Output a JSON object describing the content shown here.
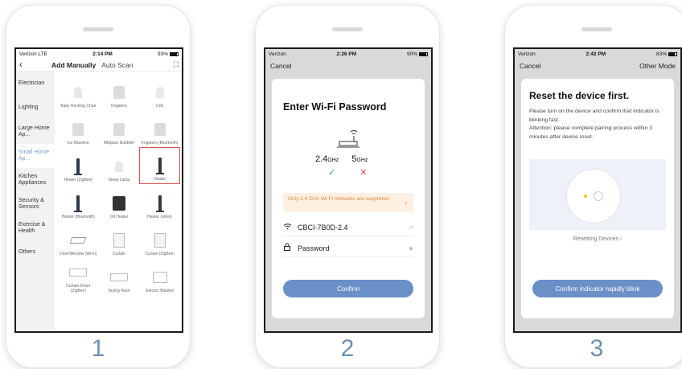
{
  "phone1": {
    "status": {
      "carrier": "Verizon  LTE",
      "time": "2:14 PM",
      "battery": "93%"
    },
    "nav": {
      "back": "‹",
      "tab_manual": "Add Manually",
      "tab_scan": "Auto Scan"
    },
    "categories": [
      "Electrician",
      "Lighting",
      "Large Home Ap...",
      "Small Home Ap...",
      "Kitchen Appliances",
      "Security & Sensors",
      "Exercise & Health",
      "Others"
    ],
    "active_category": "Small Home Ap...",
    "devices": [
      "Baby Rocking Chair",
      "Irrigators",
      "Crib",
      "Ice Machine",
      "Mittpass Bubbleh",
      "Irrigators (Bluetooth)",
      "Heater (ZigBee)",
      "Sleep Lamp",
      "Heater",
      "Heater (Bluetooth)",
      "Oil Heater",
      "Heater (other)",
      "Door/Window (Wi-Fi)",
      "Curtain",
      "Curtain (ZigBee)",
      "Curtain Motor (ZigBee)",
      "Drying Rack",
      "Electric Blanket"
    ],
    "selected_device": "Heater",
    "step": "1"
  },
  "phone2": {
    "status": {
      "carrier": "Verizon",
      "time": "2:26 PM",
      "battery": "90%"
    },
    "cancel": "Cancel",
    "title": "Enter Wi-Fi Password",
    "band_24": "2.4",
    "band_5": "5",
    "ghz": "GHz",
    "notice": "Only 2.4 GHz Wi-Fi networks are supported",
    "ssid": "CBCI-7B0D-2.4",
    "password_placeholder": "Password",
    "confirm": "Confirm",
    "step": "2"
  },
  "phone3": {
    "status": {
      "carrier": "Verizon",
      "time": "2:42 PM",
      "battery": "83%"
    },
    "cancel": "Cancel",
    "other_mode": "Other Mode",
    "title": "Reset the device first.",
    "line1": "Please turn on the device and confirm that indicator is blinking fast.",
    "line2": "Attention: please complete pairing process within 3 minutes after device reset.",
    "caption": "Resetting Devices ›",
    "confirm": "Confirm indicator rapidly blink",
    "step": "3"
  },
  "colors": {
    "accent": "#6b8fc7",
    "warning": "#e0893b",
    "selected": "#d9534f"
  }
}
